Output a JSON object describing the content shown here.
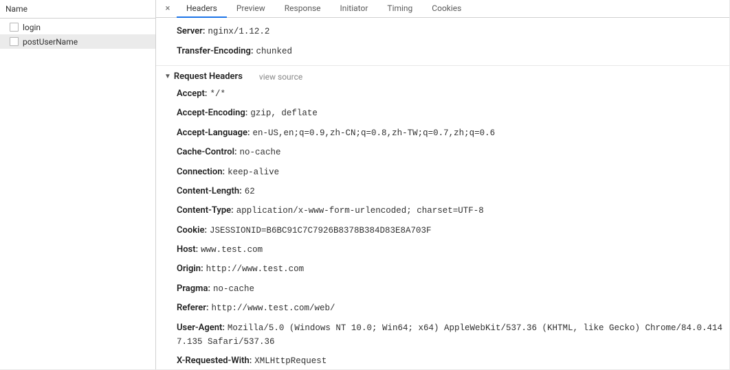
{
  "sidebar": {
    "header": "Name",
    "requests": [
      {
        "label": "login",
        "selected": false
      },
      {
        "label": "postUserName",
        "selected": true
      }
    ]
  },
  "tabs": {
    "close_glyph": "×",
    "items": [
      {
        "label": "Headers",
        "active": true
      },
      {
        "label": "Preview",
        "active": false
      },
      {
        "label": "Response",
        "active": false
      },
      {
        "label": "Initiator",
        "active": false
      },
      {
        "label": "Timing",
        "active": false
      },
      {
        "label": "Cookies",
        "active": false
      }
    ]
  },
  "response_headers_tail": [
    {
      "key": "Server",
      "value": "nginx/1.12.2"
    },
    {
      "key": "Transfer-Encoding",
      "value": "chunked"
    }
  ],
  "request_headers_section": {
    "title": "Request Headers",
    "view_source": "view source"
  },
  "request_headers": [
    {
      "key": "Accept",
      "value": "*/*"
    },
    {
      "key": "Accept-Encoding",
      "value": "gzip, deflate"
    },
    {
      "key": "Accept-Language",
      "value": "en-US,en;q=0.9,zh-CN;q=0.8,zh-TW;q=0.7,zh;q=0.6"
    },
    {
      "key": "Cache-Control",
      "value": "no-cache"
    },
    {
      "key": "Connection",
      "value": "keep-alive"
    },
    {
      "key": "Content-Length",
      "value": "62"
    },
    {
      "key": "Content-Type",
      "value": "application/x-www-form-urlencoded; charset=UTF-8"
    },
    {
      "key": "Cookie",
      "value": "JSESSIONID=B6BC91C7C7926B8378B384D83E8A703F"
    },
    {
      "key": "Host",
      "value": "www.test.com"
    },
    {
      "key": "Origin",
      "value": "http://www.test.com"
    },
    {
      "key": "Pragma",
      "value": "no-cache"
    },
    {
      "key": "Referer",
      "value": "http://www.test.com/web/"
    },
    {
      "key": "User-Agent",
      "value": "Mozilla/5.0 (Windows NT 10.0; Win64; x64) AppleWebKit/537.36 (KHTML, like Gecko) Chrome/84.0.4147.135 Safari/537.36"
    },
    {
      "key": "X-Requested-With",
      "value": "XMLHttpRequest"
    }
  ]
}
